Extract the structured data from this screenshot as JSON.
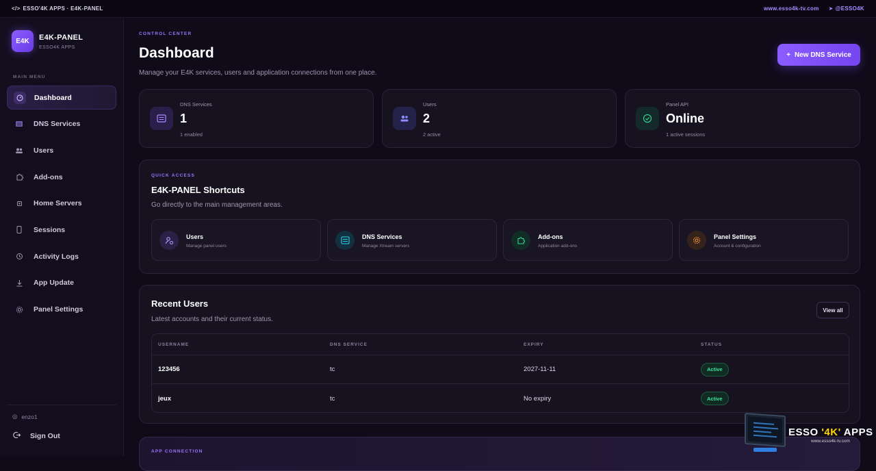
{
  "topbar": {
    "brand": "ESSO'4K APPS · E4K-PANEL",
    "website": "www.esso4k-tv.com",
    "telegram": "@ESSO4K"
  },
  "sidebar": {
    "logo_badge": "E4K",
    "app_name": "E4K-PANEL",
    "app_sub": "ESSO4K APPS",
    "menu_title": "MAIN MENU",
    "items": [
      {
        "label": "Dashboard",
        "icon": "gauge-icon",
        "active": true
      },
      {
        "label": "DNS Services",
        "icon": "server-icon"
      },
      {
        "label": "Users",
        "icon": "users-icon"
      },
      {
        "label": "Add-ons",
        "icon": "puzzle-icon"
      },
      {
        "label": "Home Servers",
        "icon": "chip-icon"
      },
      {
        "label": "Sessions",
        "icon": "phone-icon"
      },
      {
        "label": "Activity Logs",
        "icon": "history-icon"
      },
      {
        "label": "App Update",
        "icon": "download-icon"
      },
      {
        "label": "Panel Settings",
        "icon": "gear-icon"
      }
    ],
    "username": "enzo1",
    "sign_out": "Sign Out"
  },
  "header": {
    "eyebrow": "CONTROL CENTER",
    "title": "Dashboard",
    "subtitle": "Manage your E4K services, users and application connections from one place.",
    "new_button": "New DNS Service"
  },
  "stats": [
    {
      "label": "DNS Services",
      "value": "1",
      "foot": "1 enabled",
      "icon": "server-icon",
      "color": "#8b5cff"
    },
    {
      "label": "Users",
      "value": "2",
      "foot": "2 active",
      "icon": "users-icon",
      "color": "#6f6bff"
    },
    {
      "label": "Panel API",
      "value": "Online",
      "foot": "1 active sessions",
      "icon": "check-circle-icon",
      "color": "#2fd392"
    }
  ],
  "quick_access": {
    "eyebrow": "QUICK ACCESS",
    "title": "E4K-PANEL Shortcuts",
    "subtitle": "Go directly to the main management areas.",
    "shortcuts": [
      {
        "title": "Users",
        "sub": "Manage panel users",
        "icon": "user-gear-icon",
        "color": "#8b5cff"
      },
      {
        "title": "DNS Services",
        "sub": "Manage Xtream servers",
        "icon": "server-icon",
        "color": "#1fc4e0"
      },
      {
        "title": "Add-ons",
        "sub": "Application add-ons",
        "icon": "puzzle-icon",
        "color": "#2fd392"
      },
      {
        "title": "Panel Settings",
        "sub": "Account & configuration",
        "icon": "gear-icon",
        "color": "#ff8a2a"
      }
    ]
  },
  "recent_users": {
    "title": "Recent Users",
    "subtitle": "Latest accounts and their current status.",
    "view_all": "View all",
    "columns": [
      "USERNAME",
      "DNS SERVICE",
      "EXPIRY",
      "STATUS"
    ],
    "rows": [
      {
        "username": "123456",
        "dns": "tc",
        "expiry": "2027-11-11",
        "status": "Active"
      },
      {
        "username": "jeux",
        "dns": "tc",
        "expiry": "No expiry",
        "status": "Active"
      }
    ]
  },
  "app_connection": {
    "eyebrow": "APP CONNECTION"
  },
  "watermark": {
    "text_a": "ESSO ",
    "text_b": "'4K'",
    "text_c": " APPS",
    "url": "www.esso4k-tv.com"
  }
}
